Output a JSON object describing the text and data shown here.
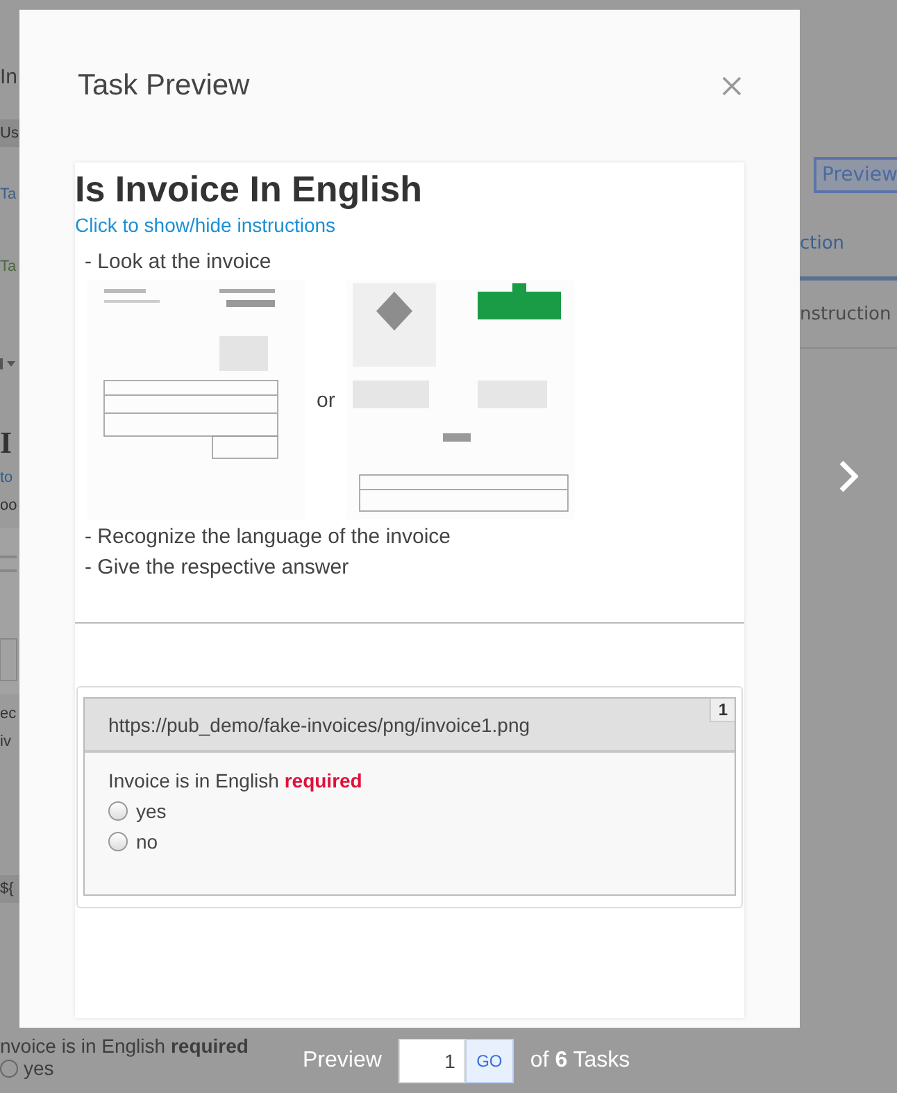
{
  "background_page": {
    "left_fragments": [
      {
        "text": "In",
        "kind": "heading"
      },
      {
        "text": "Us",
        "kind": "field"
      },
      {
        "text": "Ta",
        "kind": "tab"
      },
      {
        "text": "Ta",
        "kind": "green"
      },
      {
        "kind": "caret"
      },
      {
        "text": "I",
        "kind": "serif"
      },
      {
        "text": "to",
        "kind": "link"
      },
      {
        "text": "oo",
        "kind": "text"
      },
      {
        "kind": "thumb"
      },
      {
        "text": "ec",
        "kind": "text"
      },
      {
        "text": "iv",
        "kind": "text"
      },
      {
        "text": "${",
        "kind": "code"
      }
    ],
    "preview_button": "Preview",
    "tabs": [
      {
        "label": "ction",
        "selected": true
      },
      {
        "label": "nstruction",
        "selected": false
      }
    ],
    "question": "nvoice is in English **required**",
    "option": {
      "label": "yes",
      "selected": false
    }
  },
  "modal": {
    "title": "Task Preview"
  },
  "task": {
    "heading": "Is Invoice In English",
    "instructions_link": "Click to show/hide instructions",
    "steps_before": [
      "- Look at the invoice"
    ],
    "separator": "or",
    "steps_after": [
      "- Recognize the language of the invoice",
      "- Give the respective answer"
    ],
    "panel": {
      "url": "https://pub_demo/fake-invoices/png/invoice1.png",
      "number": "1",
      "question": "Invoice is in English",
      "required": "required",
      "options": [
        {
          "label": "yes",
          "selected": false
        },
        {
          "label": "no",
          "selected": false
        }
      ]
    }
  },
  "pager": {
    "label": "Preview",
    "value": "1",
    "button": "GO",
    "suffix": "of **6** Tasks"
  }
}
